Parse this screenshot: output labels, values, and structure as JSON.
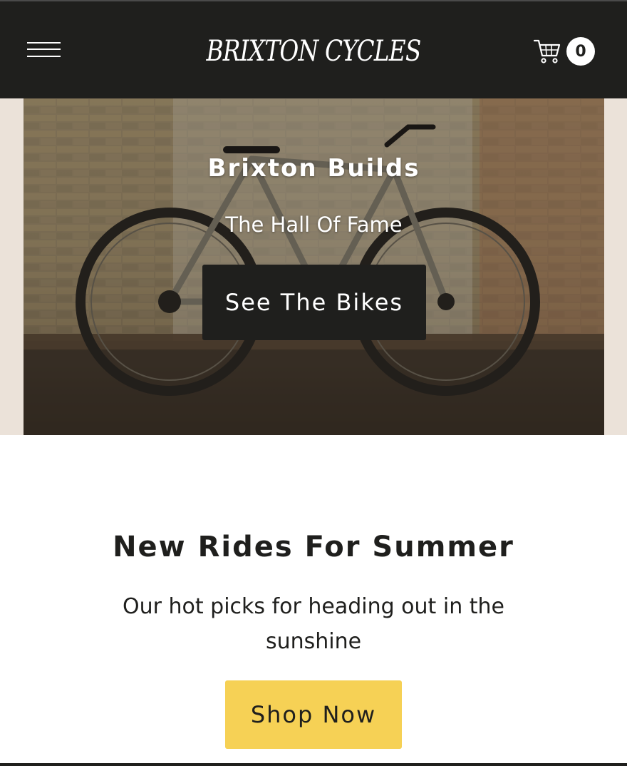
{
  "header": {
    "logo_text": "BRIXTON CYCLES",
    "menu_icon": "hamburger-menu-icon",
    "cart_icon": "shopping-cart-icon",
    "cart_count": "0"
  },
  "hero": {
    "title": "Brixton Builds",
    "subtitle": "The Hall Of Fame",
    "button_label": "See The Bikes"
  },
  "promo": {
    "title": "New Rides For Summer",
    "subtitle": "Our hot picks for heading out in the sunshine",
    "button_label": "Shop Now"
  },
  "colors": {
    "header_bg": "#1f1f1d",
    "hero_side_bg": "#ebe2d9",
    "accent_button": "#f6d155",
    "text_dark": "#1f1f1d"
  }
}
